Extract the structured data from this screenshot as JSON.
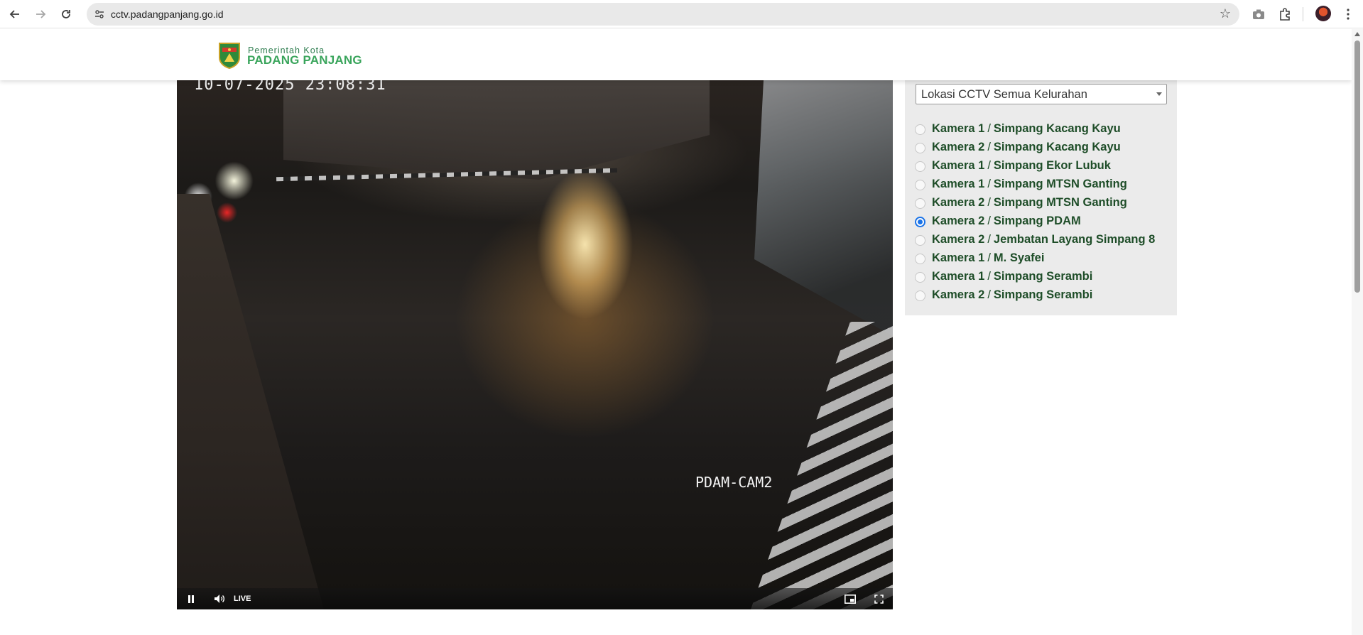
{
  "browser": {
    "url": "cctv.padangpanjang.go.id"
  },
  "header": {
    "logo_line1": "Pemerintah Kota",
    "logo_line2": "PADANG PANJANG"
  },
  "video": {
    "timestamp": "10-07-2025 23:08:31",
    "camera_label": "PDAM-CAM2",
    "live_label": "LIVE",
    "state": "playing"
  },
  "panel": {
    "location_select": "Lokasi CCTV Semua Kelurahan",
    "separator": "/",
    "cameras": [
      {
        "camera": "Kamera 1",
        "location": "Simpang Kacang Kayu",
        "selected": false
      },
      {
        "camera": "Kamera 2",
        "location": "Simpang Kacang Kayu",
        "selected": false
      },
      {
        "camera": "Kamera 1",
        "location": "Simpang Ekor Lubuk",
        "selected": false
      },
      {
        "camera": "Kamera 1",
        "location": "Simpang MTSN Ganting",
        "selected": false
      },
      {
        "camera": "Kamera 2",
        "location": "Simpang MTSN Ganting",
        "selected": false
      },
      {
        "camera": "Kamera 2",
        "location": "Simpang PDAM",
        "selected": true
      },
      {
        "camera": "Kamera 2",
        "location": "Jembatan Layang Simpang 8",
        "selected": false
      },
      {
        "camera": "Kamera 1",
        "location": "M. Syafei",
        "selected": false
      },
      {
        "camera": "Kamera 1",
        "location": "Simpang Serambi",
        "selected": false
      },
      {
        "camera": "Kamera 2",
        "location": "Simpang Serambi",
        "selected": false
      }
    ]
  },
  "colors": {
    "camera_text": "#1e4d28",
    "logo_green": "#3aa55c",
    "radio_selected": "#1a73e8"
  }
}
